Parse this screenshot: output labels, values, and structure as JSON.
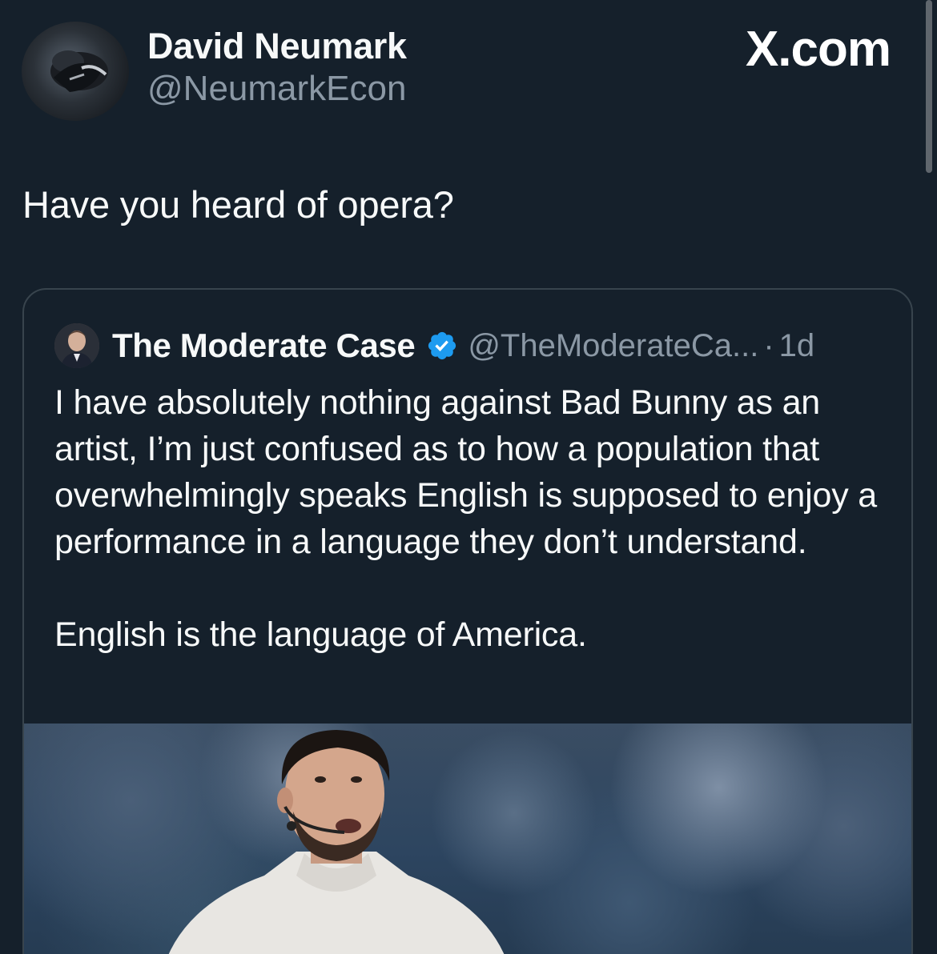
{
  "post": {
    "author": {
      "name": "David Neumark",
      "handle": "@NeumarkEcon",
      "avatar_icon": "user-avatar"
    },
    "brand": "X.com",
    "text": "Have you heard of opera?"
  },
  "quote": {
    "author": {
      "name": "The Moderate Case",
      "handle": "@TheModerateCa...",
      "verified": true,
      "verified_color": "#1d9bf0",
      "avatar_icon": "user-avatar"
    },
    "separator": "·",
    "time": "1d",
    "paragraphs": [
      "I have absolutely nothing against Bad Bunny as an artist, I’m just confused as to how a population that overwhelmingly speaks English is supposed to enjoy a performance in a language they don’t understand.",
      "English is the language of America."
    ],
    "media": {
      "kind": "photo"
    }
  },
  "theme": {
    "background": "#15202b",
    "primary_text": "#f7f9f9",
    "secondary_text": "#8b98a5",
    "border": "#38444d"
  }
}
